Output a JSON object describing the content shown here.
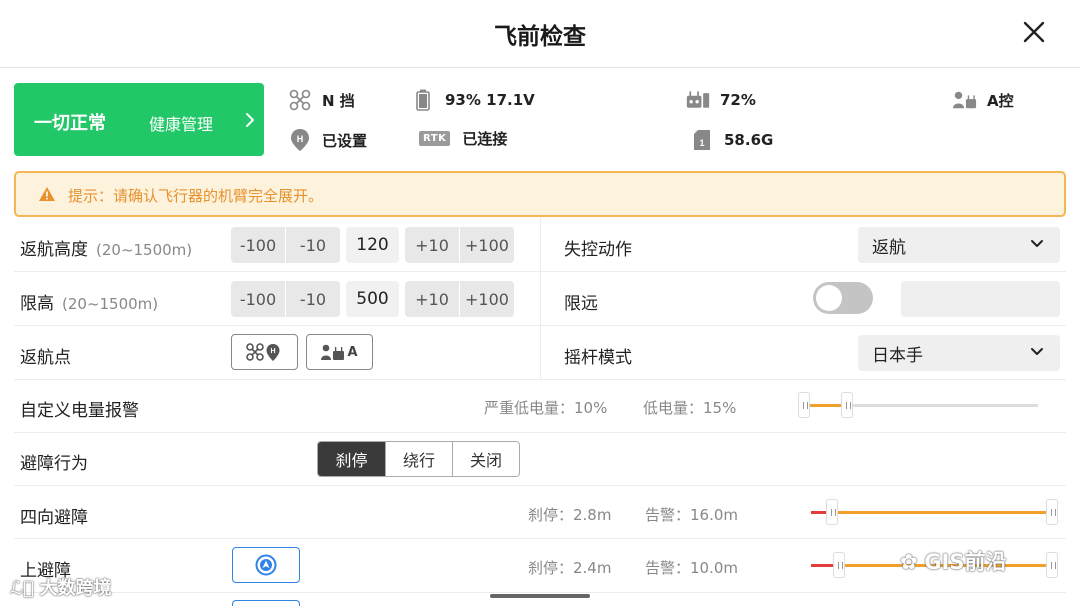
{
  "header": {
    "title": "飞前检查"
  },
  "status_card": {
    "label": "一切正常",
    "health_label": "健康管理"
  },
  "stats": {
    "gear": "N 挡",
    "battery": "93%  17.1V",
    "rc_signal": "72%",
    "control": "A控",
    "home_point": "已设置",
    "rtk_badge": "RTK",
    "rtk_status": "已连接",
    "storage": "58.6G"
  },
  "alert": {
    "text": "提示：请确认飞行器的机臂完全展开。"
  },
  "rth_altitude": {
    "label": "返航高度",
    "range": "(20~1500m)",
    "buttons": [
      "-100",
      "-10",
      "+10",
      "+100"
    ],
    "value": "120"
  },
  "signal_lost_action": {
    "label": "失控动作",
    "value": "返航"
  },
  "altitude_limit": {
    "label": "限高",
    "range": "(20~1500m)",
    "buttons": [
      "-100",
      "-10",
      "+10",
      "+100"
    ],
    "value": "500"
  },
  "distance_limit": {
    "label": "限远",
    "enabled": false
  },
  "home_point": {
    "label": "返航点",
    "rc_button_label": "A"
  },
  "stick_mode": {
    "label": "摇杆模式",
    "value": "日本手"
  },
  "battery_warning": {
    "label": "自定义电量报警",
    "critical": "严重低电量：10%",
    "low": "低电量：15%",
    "critical_value": 10,
    "low_value": 15
  },
  "obstacle_behavior": {
    "label": "避障行为",
    "options": [
      "刹停",
      "绕行",
      "关闭"
    ],
    "selected": "刹停"
  },
  "horizontal_avoidance": {
    "label": "四向避障",
    "brake": "刹停：2.8m",
    "warn": "告警：16.0m"
  },
  "upward_avoidance": {
    "label": "上避障",
    "brake": "刹停：2.4m",
    "warn": "告警：10.0m"
  },
  "watermarks": {
    "left": "大数跨境",
    "right": "GIS前沿"
  },
  "colors": {
    "ok_green": "#22c768",
    "warning_orange": "#e8912d",
    "slider_orange": "#f0a02a",
    "slider_red": "#e23c3c",
    "accent_blue": "#2f83e6"
  }
}
